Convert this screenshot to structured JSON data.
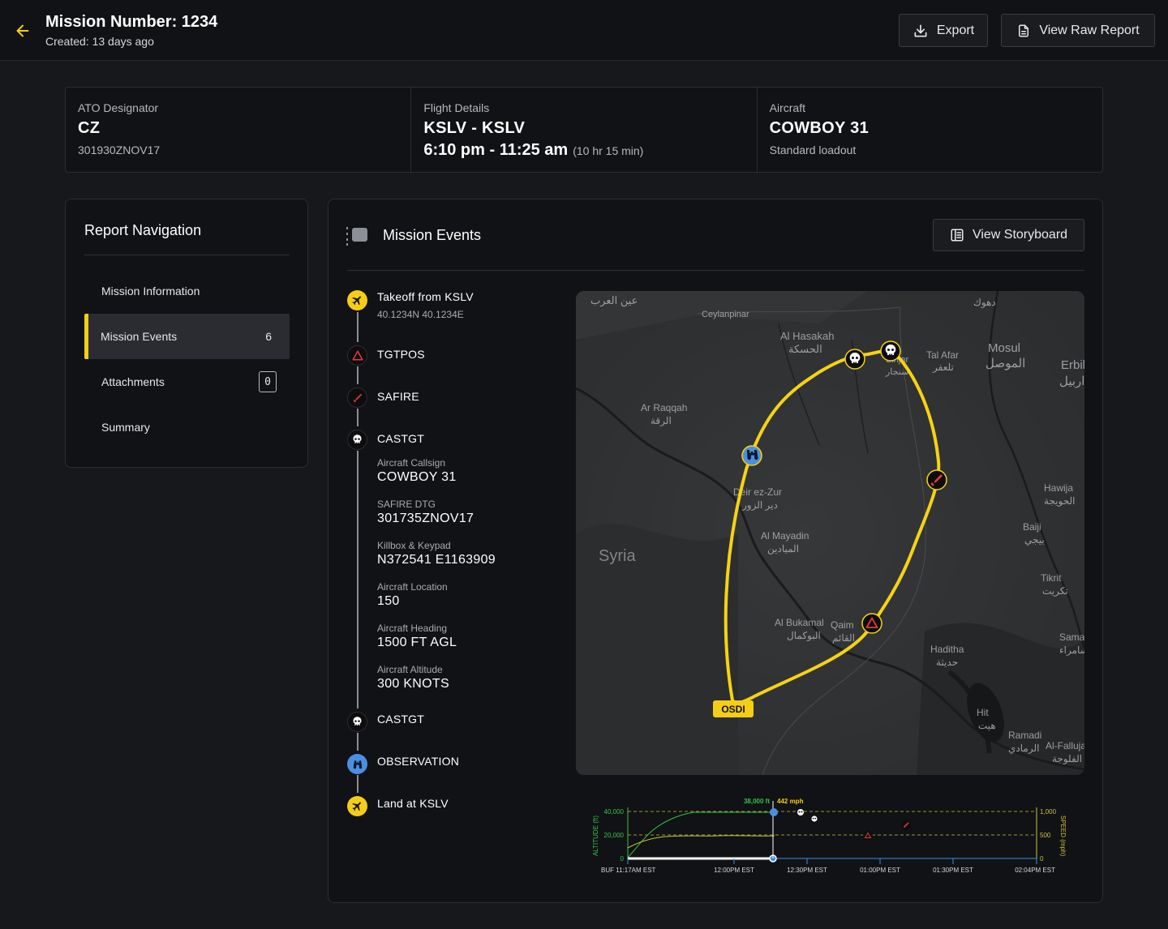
{
  "header": {
    "title": "Mission Number: 1234",
    "created": "Created: 13 days ago",
    "export_label": "Export",
    "raw_report_label": "View Raw Report"
  },
  "summary": {
    "ato": {
      "label": "ATO Designator",
      "value": "CZ",
      "sub": "301930ZNOV17"
    },
    "flight": {
      "label": "Flight Details",
      "route": "KSLV - KSLV",
      "time": "6:10 pm - 11:25 am",
      "duration": "(10 hr 15 min)"
    },
    "aircraft": {
      "label": "Aircraft",
      "value": "COWBOY 31",
      "sub": "Standard loadout"
    }
  },
  "nav": {
    "title": "Report Navigation",
    "items": [
      {
        "label": "Mission Information"
      },
      {
        "label": "Mission Events",
        "count": "6"
      },
      {
        "label": "Attachments",
        "count": "0"
      },
      {
        "label": "Summary"
      }
    ]
  },
  "events": {
    "title": "Mission Events",
    "storyboard_label": "View Storyboard",
    "timeline": [
      {
        "label": "Takeoff from KSLV",
        "coord": "40.1234N 40.1234E",
        "icon": "airplane-icon"
      },
      {
        "label": "TGTPOS",
        "icon": "triangle-warning-icon"
      },
      {
        "label": "SAFIRE",
        "icon": "missile-icon"
      },
      {
        "label": "CASTGT",
        "icon": "skull-icon",
        "fields": [
          {
            "label": "Aircraft Callsign",
            "value": "COWBOY 31"
          },
          {
            "label": "SAFIRE DTG",
            "value": "301735ZNOV17"
          },
          {
            "label": "Killbox & Keypad",
            "value": "N372541 E1163909"
          },
          {
            "label": "Aircraft Location",
            "value": "150"
          },
          {
            "label": "Aircraft Heading",
            "value": "1500 FT AGL"
          },
          {
            "label": "Aircraft Altitude",
            "value": "300 KNOTS"
          }
        ]
      },
      {
        "label": "CASTGT",
        "icon": "skull-icon"
      },
      {
        "label": "OBSERVATION",
        "icon": "binoculars-icon"
      },
      {
        "label": "Land at KSLV",
        "icon": "airplane-icon"
      }
    ]
  },
  "map": {
    "start_label": "OSDI",
    "places": [
      {
        "name": "عين العرب"
      },
      {
        "name": "Ceylanpinar"
      },
      {
        "name": "Al Hasakah"
      },
      {
        "name": "الحسكة"
      },
      {
        "name": "Tal Afar"
      },
      {
        "name": "تلعفر"
      },
      {
        "name": "Mosul"
      },
      {
        "name": "الموصل"
      },
      {
        "name": "Erbil"
      },
      {
        "name": "اربيل"
      },
      {
        "name": "دهوك"
      },
      {
        "name": "Sinjar"
      },
      {
        "name": "سنجار"
      },
      {
        "name": "Ar Raqqah"
      },
      {
        "name": "الرقة"
      },
      {
        "name": "Deir ez-Zur"
      },
      {
        "name": "دير الزور"
      },
      {
        "name": "Al Mayadin"
      },
      {
        "name": "الميادين"
      },
      {
        "name": "Syria"
      },
      {
        "name": "Hawija"
      },
      {
        "name": "الحويجة"
      },
      {
        "name": "Baiji"
      },
      {
        "name": "بيجي"
      },
      {
        "name": "Tikrit"
      },
      {
        "name": "تكريت"
      },
      {
        "name": "Samarra"
      },
      {
        "name": "سامراء"
      },
      {
        "name": "Al Bukamal"
      },
      {
        "name": "البوكمال"
      },
      {
        "name": "Qaim"
      },
      {
        "name": "القائم"
      },
      {
        "name": "Haditha"
      },
      {
        "name": "حديثة"
      },
      {
        "name": "Hit"
      },
      {
        "name": "هيت"
      },
      {
        "name": "Ramadi"
      },
      {
        "name": "الرمادي"
      },
      {
        "name": "Al-Fallujah"
      },
      {
        "name": "الفلوجة"
      }
    ]
  },
  "chart": {
    "readout_alt": "38,000 ft",
    "readout_speed": "442 mph",
    "y_left_label": "ALTITUDE (ft)",
    "y_right_label": "SPEED (mph)",
    "y_left_ticks": [
      "40,000",
      "20,000",
      "0"
    ],
    "y_right_ticks": [
      "1,000",
      "500",
      "0"
    ],
    "x_ticks": [
      "BUF 11:17AM EST",
      "12:00PM EST",
      "12:30PM EST",
      "01:00PM EST",
      "01:30PM EST",
      "02:04PM EST"
    ]
  },
  "colors": {
    "accent": "#f5cd16",
    "route": "#f5d312",
    "altitude_line": "#37c24a",
    "speed_line": "#c9c23a",
    "hostile": "#e23b3b",
    "observation": "#4c8fe0"
  }
}
